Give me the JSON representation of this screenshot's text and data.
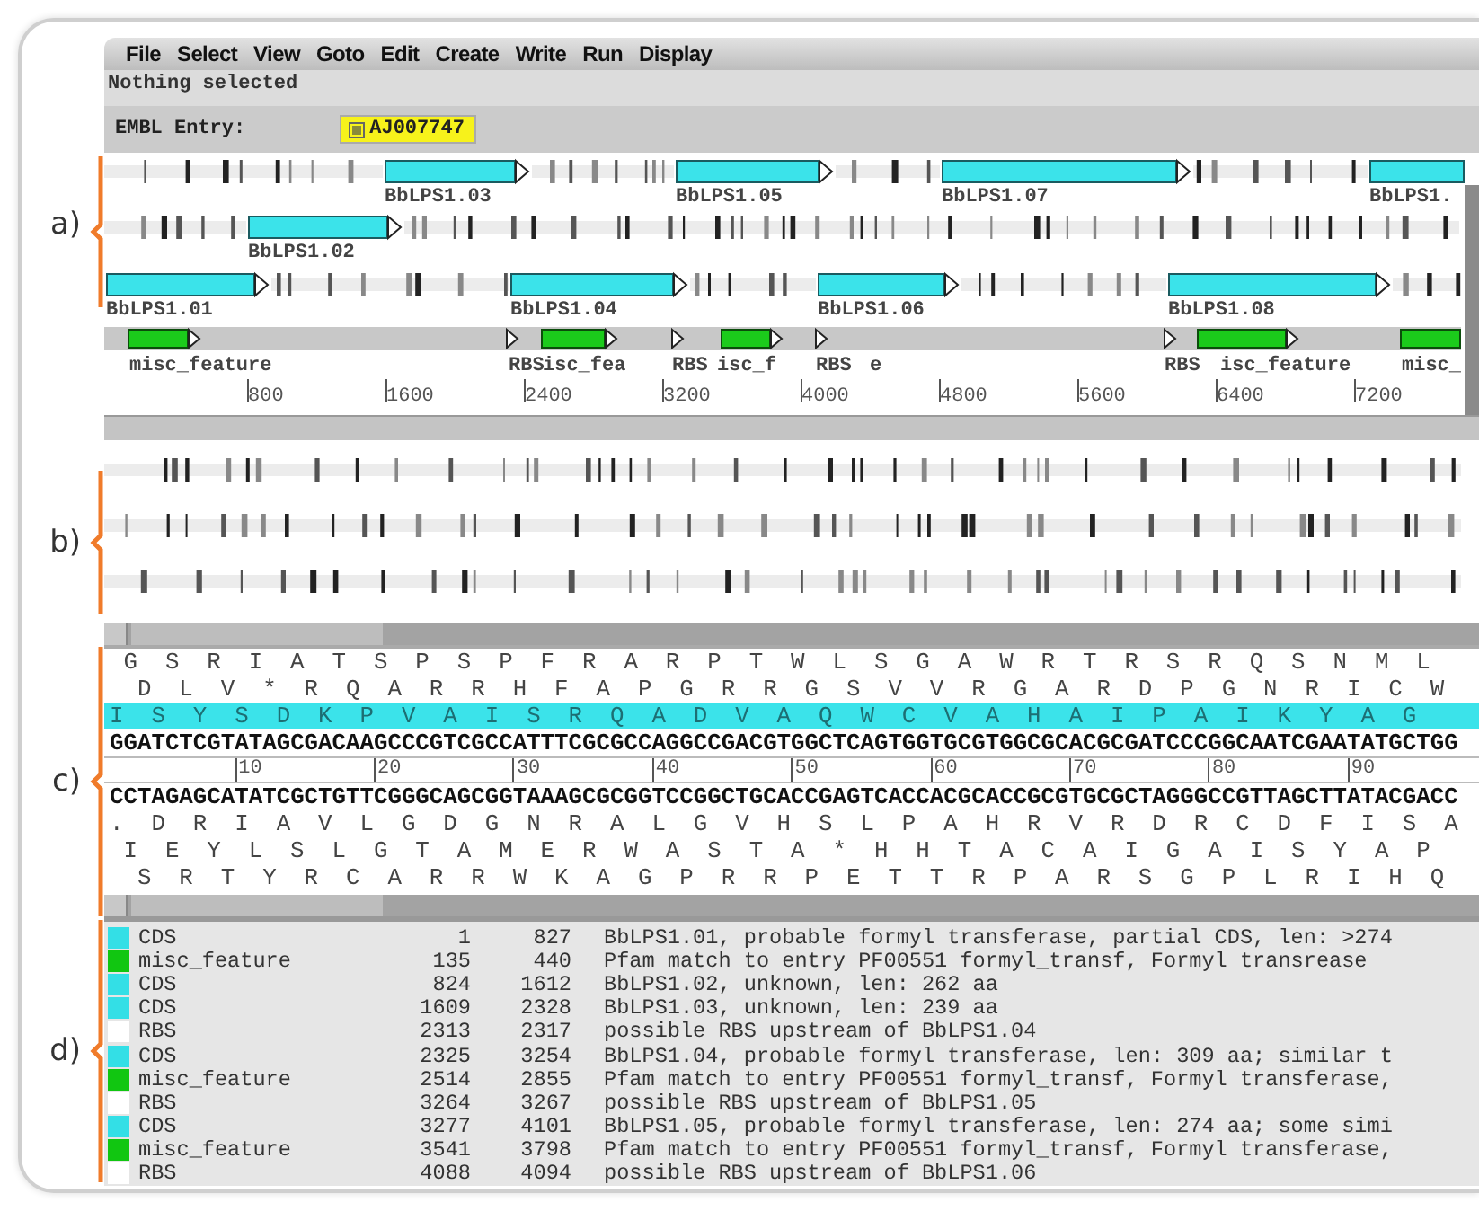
{
  "menu": [
    "File",
    "Select",
    "View",
    "Goto",
    "Edit",
    "Create",
    "Write",
    "Run",
    "Display"
  ],
  "status": "Nothing selected",
  "entry": {
    "label": "EMBL Entry:",
    "name": "AJ007747",
    "checked": true
  },
  "feature_map": {
    "panel_label": "a)",
    "frames": [
      {
        "features": [
          {
            "label": "BbLPS1.03"
          },
          {
            "label": "BbLPS1.05"
          },
          {
            "label": "BbLPS1.07"
          },
          {
            "label": "BbLPS1."
          }
        ]
      },
      {
        "features": [
          {
            "label": "BbLPS1.02"
          }
        ]
      },
      {
        "features": [
          {
            "label": "BbLPS1.01"
          },
          {
            "label": "BbLPS1.04"
          },
          {
            "label": "BbLPS1.06"
          },
          {
            "label": "BbLPS1.08"
          }
        ]
      }
    ],
    "misc_track": [
      {
        "kind": "misc",
        "label": "misc_feature"
      },
      {
        "kind": "rbs",
        "label": "RBS"
      },
      {
        "kind": "misc",
        "label": "isc_fea"
      },
      {
        "kind": "rbs",
        "label": "RBS"
      },
      {
        "kind": "misc",
        "label": "isc_f"
      },
      {
        "kind": "rbs",
        "label": "RBS"
      },
      {
        "kind": "text",
        "label": "e"
      },
      {
        "kind": "rbs",
        "label": "RBS"
      },
      {
        "kind": "misc",
        "label": "isc_feature"
      },
      {
        "kind": "misc",
        "label": "misc_"
      }
    ],
    "scale": [
      "800",
      "1600",
      "2400",
      "3200",
      "4000",
      "4800",
      "5600",
      "6400",
      "7200"
    ]
  },
  "stop_codon_view": {
    "panel_label": "b)"
  },
  "sequence_view": {
    "panel_label": "c)",
    "forward_frames": [
      {
        "residues": "G S R I A T S P S P F R A R P T W L S G A W R T R S R Q S N M L",
        "highlighted": false
      },
      {
        "residues": "D L V * R Q A R R H F A P G R R G S V V R G A R D P G N R I C W",
        "highlighted": false
      },
      {
        "residues": "I S Y S D K P V A I S R Q A D V A Q W C V A H A I P A I K Y A G",
        "highlighted": true
      }
    ],
    "forward_dna": "GGATCTCGTATAGCGACAAGCCCGTCGCCATTTCGCGCCAGGCCGACGTGGCTCAGTGGTGCGTGGCGCACGCGATCCCGGCAATCGAATATGCTGG",
    "scale": [
      "10",
      "20",
      "30",
      "40",
      "50",
      "60",
      "70",
      "80",
      "90"
    ],
    "reverse_dna": "CCTAGAGCATATCGCTGTTCGGGCAGCGGTAAAGCGCGGTCCGGCTGCACCGAGTCACCACGCACCGCGTGCGCTAGGGCCGTTAGCTTATACGACC",
    "reverse_frames": [
      {
        "residues": ". D R I A V L G D G N R A L G V H S L P A H R V R D R C D F I S A",
        "highlighted": false
      },
      {
        "residues": "I E Y L S L G T A M E R W A S T A * H H T A C A I G A I S Y A P",
        "highlighted": false
      },
      {
        "residues": "S R T Y R C A R R W K A G P R R P E T T R P A R S G P L R I H Q",
        "highlighted": false
      }
    ]
  },
  "feature_list": {
    "panel_label": "d)",
    "rows": [
      {
        "type": "CDS",
        "color": "#33dfe6",
        "start": "1",
        "end": "827",
        "description": "BbLPS1.01, probable formyl transferase, partial CDS, len: >274"
      },
      {
        "type": "misc_feature",
        "color": "#11c611",
        "start": "135",
        "end": "440",
        "description": "Pfam match to entry PF00551 formyl_transf, Formyl transrease"
      },
      {
        "type": "CDS",
        "color": "#33dfe6",
        "start": "824",
        "end": "1612",
        "description": "BbLPS1.02, unknown, len: 262 aa"
      },
      {
        "type": "CDS",
        "color": "#33dfe6",
        "start": "1609",
        "end": "2328",
        "description": "BbLPS1.03, unknown, len: 239 aa"
      },
      {
        "type": "RBS",
        "color": "#ffffff",
        "start": "2313",
        "end": "2317",
        "description": "possible RBS upstream of BbLPS1.04"
      },
      {
        "type": "CDS",
        "color": "#33dfe6",
        "start": "2325",
        "end": "3254",
        "description": "BbLPS1.04, probable formyl transferase, len: 309 aa; similar t"
      },
      {
        "type": "misc_feature",
        "color": "#11c611",
        "start": "2514",
        "end": "2855",
        "description": "Pfam match to entry PF00551 formyl_transf, Formyl transferase,"
      },
      {
        "type": "RBS",
        "color": "#ffffff",
        "start": "3264",
        "end": "3267",
        "description": "possible RBS upstream of BbLPS1.05"
      },
      {
        "type": "CDS",
        "color": "#33dfe6",
        "start": "3277",
        "end": "4101",
        "description": "BbLPS1.05, probable formyl transferase, len: 274 aa; some simi"
      },
      {
        "type": "misc_feature",
        "color": "#11c611",
        "start": "3541",
        "end": "3798",
        "description": "Pfam match to entry PF00551 formyl_transf, Formyl transferase,"
      },
      {
        "type": "RBS",
        "color": "#ffffff",
        "start": "4088",
        "end": "4094",
        "description": "possible RBS upstream of BbLPS1.06"
      }
    ]
  }
}
